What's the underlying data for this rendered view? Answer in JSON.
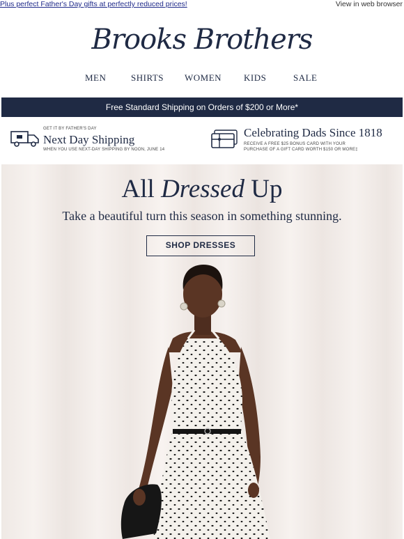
{
  "preheader": {
    "left_link": "Plus perfect Father's Day gifts at perfectly reduced prices!",
    "right_link": "View in web browser"
  },
  "brand": {
    "logo_text": "Brooks Brothers",
    "color": "#1f2a44"
  },
  "nav": [
    {
      "label": "MEN"
    },
    {
      "label": "SHIRTS"
    },
    {
      "label": "WOMEN"
    },
    {
      "label": "KIDS"
    },
    {
      "label": "SALE"
    }
  ],
  "shipping_bar": {
    "text": "Free Standard Shipping on Orders of $200 or More*"
  },
  "promos": [
    {
      "icon": "delivery-truck-icon",
      "eyebrow": "GET IT BY FATHER'S DAY",
      "title": "Next Day Shipping",
      "detail": "WHEN YOU USE NEXT-DAY SHIPPING BY NOON, JUNE 14"
    },
    {
      "icon": "gift-card-icon",
      "title": "Celebrating Dads Since 1818",
      "detail_line1": "RECEIVE A FREE $25 BONUS CARD WITH YOUR",
      "detail_line2": "PURCHASE OF A GIFT CARD WORTH $150 OR MORE‡"
    }
  ],
  "hero": {
    "title_part1": "All ",
    "title_italic": "Dressed",
    "title_part2": " Up",
    "subtitle": "Take a beautiful turn this season in something stunning.",
    "cta_label": "SHOP DRESSES",
    "image": "model-in-polka-dot-halter-dress"
  }
}
